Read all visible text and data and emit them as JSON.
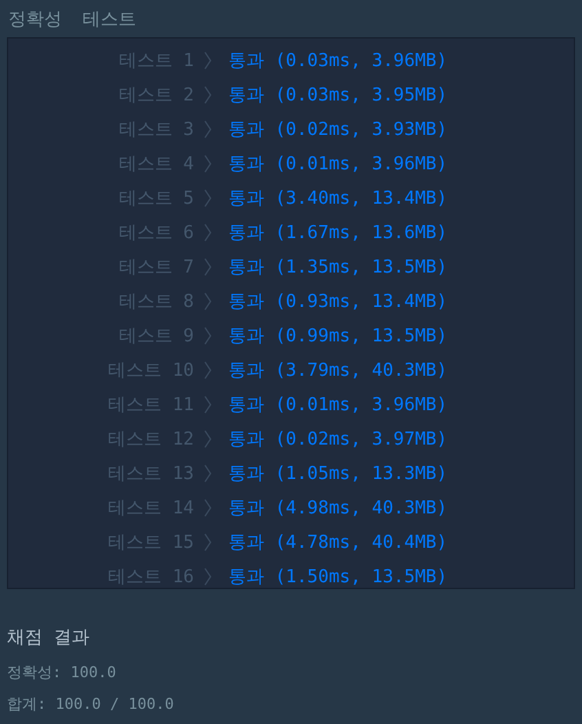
{
  "tabs": [
    {
      "label": "정확성",
      "selected": false
    },
    {
      "label": "테스트",
      "selected": false
    }
  ],
  "tests": [
    {
      "label": "테스트 1",
      "result": "통과 (0.03ms, 3.96MB)"
    },
    {
      "label": "테스트 2",
      "result": "통과 (0.03ms, 3.95MB)"
    },
    {
      "label": "테스트 3",
      "result": "통과 (0.02ms, 3.93MB)"
    },
    {
      "label": "테스트 4",
      "result": "통과 (0.01ms, 3.96MB)"
    },
    {
      "label": "테스트 5",
      "result": "통과 (3.40ms, 13.4MB)"
    },
    {
      "label": "테스트 6",
      "result": "통과 (1.67ms, 13.6MB)"
    },
    {
      "label": "테스트 7",
      "result": "통과 (1.35ms, 13.5MB)"
    },
    {
      "label": "테스트 8",
      "result": "통과 (0.93ms, 13.4MB)"
    },
    {
      "label": "테스트 9",
      "result": "통과 (0.99ms, 13.5MB)"
    },
    {
      "label": "테스트 10",
      "result": "통과 (3.79ms, 40.3MB)"
    },
    {
      "label": "테스트 11",
      "result": "통과 (0.01ms, 3.96MB)"
    },
    {
      "label": "테스트 12",
      "result": "통과 (0.02ms, 3.97MB)"
    },
    {
      "label": "테스트 13",
      "result": "통과 (1.05ms, 13.3MB)"
    },
    {
      "label": "테스트 14",
      "result": "통과 (4.98ms, 40.3MB)"
    },
    {
      "label": "테스트 15",
      "result": "통과 (4.78ms, 40.4MB)"
    },
    {
      "label": "테스트 16",
      "result": "통과 (1.50ms, 13.5MB)"
    }
  ],
  "grading": {
    "title": "채점 결과",
    "accuracy": "정확성: 100.0",
    "total": "합계: 100.0 / 100.0"
  }
}
